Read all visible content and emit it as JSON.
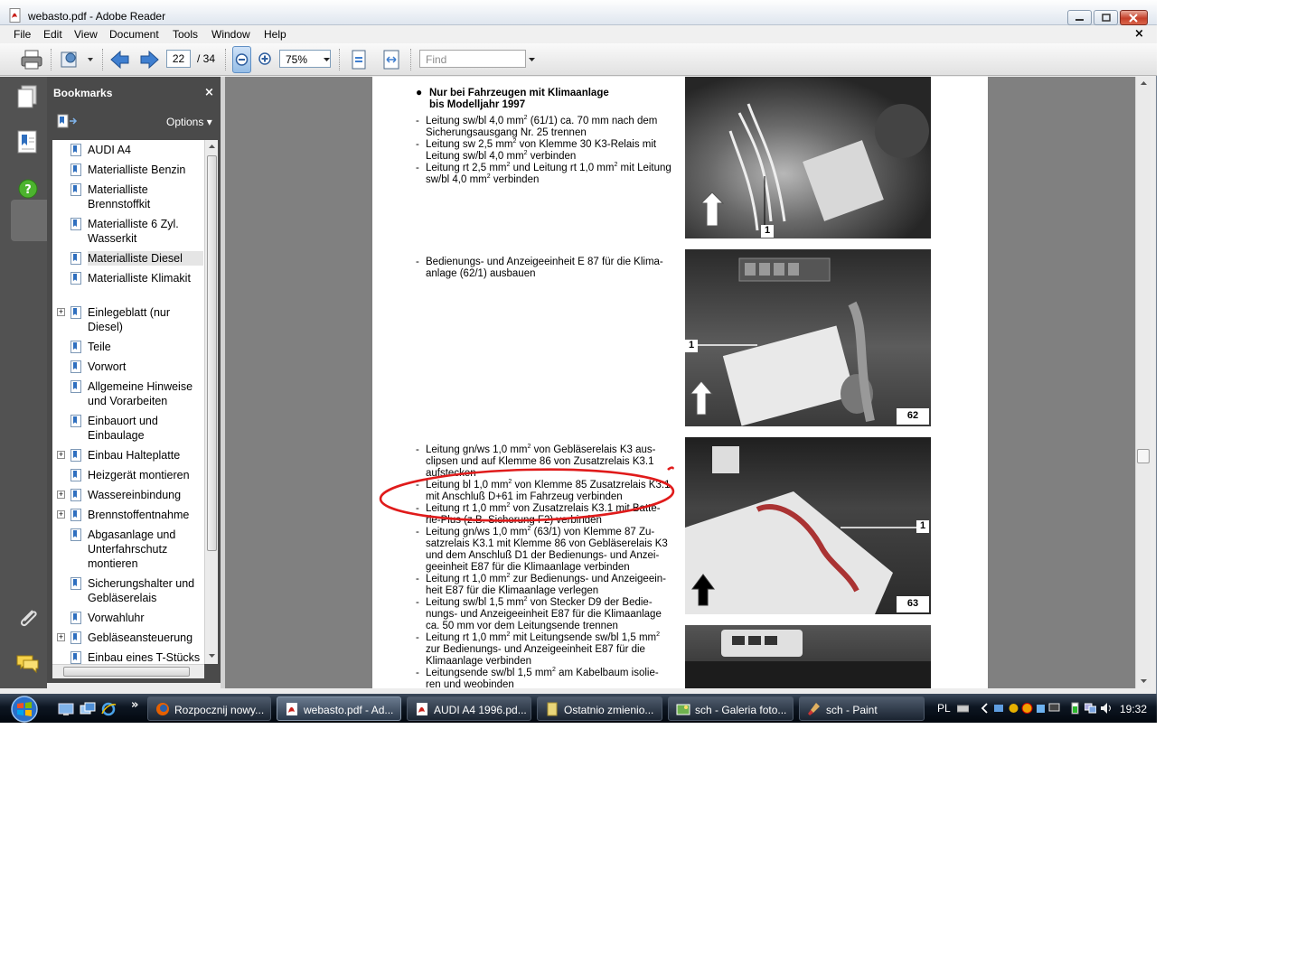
{
  "window": {
    "title": "webasto.pdf - Adobe Reader",
    "menus": [
      "File",
      "Edit",
      "View",
      "Document",
      "Tools",
      "Window",
      "Help"
    ],
    "doc_close": "×"
  },
  "toolbar": {
    "current_page": "22",
    "page_total": "/ 34",
    "zoom": "75%",
    "find_placeholder": "Find"
  },
  "bookmarks": {
    "title": "Bookmarks",
    "close": "×",
    "options_label": "Options ▾",
    "items": [
      {
        "label": "AUDI A4",
        "expand": false
      },
      {
        "label": "Materialliste Benzin",
        "expand": false
      },
      {
        "label": "Materialliste Brennstoffkit",
        "expand": false
      },
      {
        "label": "Materialliste 6 Zyl. Wasserkit",
        "expand": false
      },
      {
        "label": "Materialliste Diesel",
        "expand": false,
        "selected": true
      },
      {
        "label": "Materialliste Klimakit",
        "expand": false
      },
      {
        "label": "Einlegeblatt (nur Diesel)",
        "expand": true
      },
      {
        "label": "Teile",
        "expand": false
      },
      {
        "label": "Vorwort",
        "expand": false
      },
      {
        "label": "Allgemeine Hinweise und Vorarbeiten",
        "expand": false
      },
      {
        "label": "Einbauort und Einbaulage",
        "expand": false
      },
      {
        "label": "Einbau Halteplatte",
        "expand": true
      },
      {
        "label": "Heizgerät montieren",
        "expand": false
      },
      {
        "label": "Wassereinbindung",
        "expand": true
      },
      {
        "label": "Brennstoffentnahme",
        "expand": true
      },
      {
        "label": "Abgasanlage und Unterfahrschutz montieren",
        "expand": false
      },
      {
        "label": "Sicherungshalter und Gebläserelais",
        "expand": false
      },
      {
        "label": "Vorwahluhr",
        "expand": false
      },
      {
        "label": "Gebläseansteuerung",
        "expand": true
      },
      {
        "label": "Einbau eines T-Stücks und eines",
        "expand": false
      }
    ]
  },
  "document": {
    "heading_line1": "Nur bei Fahrzeugen mit Klimaanlage",
    "heading_line2": "bis Modelljahr 1997",
    "block1": [
      "Leitung sw/bl 4,0 mm² (61/1) ca. 70 mm nach dem",
      "Sicherungsausgang Nr. 25 trennen",
      "Leitung sw 2,5 mm² von Klemme 30 K3-Relais mit",
      "Leitung sw/bl 4,0 mm² verbinden",
      "Leitung rt 2,5 mm² und Leitung rt 1,0 mm² mit Leitung",
      "sw/bl 4,0 mm² verbinden"
    ],
    "block2": [
      "Bedienungs- und Anzeigeeinheit E 87 für die Klima-",
      "anlage (62/1) ausbauen"
    ],
    "block3": [
      "Leitung gn/ws 1,0 mm² von Gebläserelais K3 aus-",
      "clipsen und auf Klemme 86 von Zusatzrelais K3.1",
      "aufstecken",
      "Leitung bl 1,0 mm² von Klemme 85 Zusatzrelais K3.1",
      "mit Anschluß D+61 im Fahrzeug verbinden",
      "Leitung rt 1,0 mm² von Zusatzrelais K3.1 mit Batte-",
      "rie-Plus (z.B. Sicherung F2) verbinden",
      "Leitung gn/ws 1,0 mm² (63/1) von Klemme 87 Zu-",
      "satzrelais K3.1 mit Klemme 86 von Gebläserelais K3",
      "und dem Anschluß D1 der Bedienungs- und Anzei-",
      "geeinheit E87 für die Klimaanlage verbinden",
      "Leitung rt 1,0 mm² zur Bedienungs- und Anzeigeein-",
      "heit E87 für die Klimaanlage verlegen",
      "Leitung sw/bl 1,5 mm² von Stecker D9 der Bedie-",
      "nungs- und Anzeigeeinheit E87 für die Klimaanlage",
      "ca. 50 mm vor dem Leitungsende trennen",
      "Leitung rt 1,0 mm² mit Leitungsende sw/bl 1,5 mm²",
      "zur Bedienungs- und Anzeigeeinheit E87 für die",
      "Klimaanlage verbinden",
      "Leitungsende sw/bl 1,5 mm² am Kabelbaum isolie-",
      "ren und weobinden"
    ],
    "fig_labels": {
      "callout_1": "1",
      "fig62": "62",
      "fig63": "63"
    }
  },
  "taskbar": {
    "tasks": [
      {
        "label": "Rozpocznij nowy...",
        "active": false
      },
      {
        "label": "webasto.pdf - Ad...",
        "active": true
      },
      {
        "label": "AUDI A4 1996.pd...",
        "active": false
      },
      {
        "label": "Ostatnio zmienio...",
        "active": false
      },
      {
        "label": "sch - Galeria foto...",
        "active": false
      },
      {
        "label": "sch - Paint",
        "active": false
      }
    ],
    "language": "PL",
    "clock": "19:32",
    "overflow": "»"
  }
}
